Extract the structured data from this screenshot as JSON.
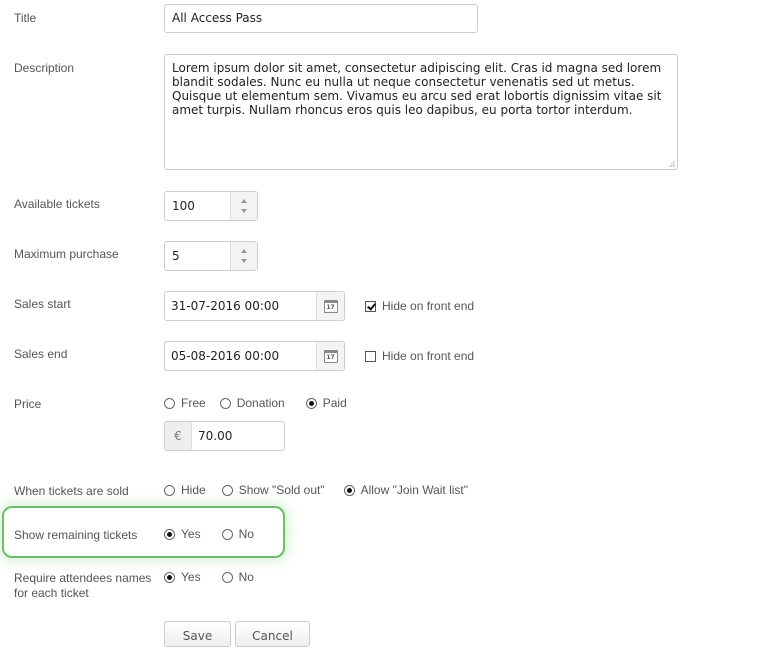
{
  "form": {
    "title": {
      "label": "Title",
      "value": "All Access Pass"
    },
    "description": {
      "label": "Description",
      "value": "Lorem ipsum dolor sit amet, consectetur adipiscing elit. Cras id magna sed lorem blandit sodales. Nunc eu nulla ut neque consectetur venenatis sed ut metus. Quisque ut elementum sem. Vivamus eu arcu sed erat lobortis dignissim vitae sit amet turpis. Nullam rhoncus eros quis leo dapibus, eu porta tortor interdum."
    },
    "available_tickets": {
      "label": "Available tickets",
      "value": "100"
    },
    "maximum_purchase": {
      "label": "Maximum purchase",
      "value": "5"
    },
    "sales_start": {
      "label": "Sales start",
      "value": "31-07-2016 00:00",
      "calendar_day": "17",
      "hide_label": "Hide on front end",
      "hide_checked": true
    },
    "sales_end": {
      "label": "Sales end",
      "value": "05-08-2016 00:00",
      "calendar_day": "17",
      "hide_label": "Hide on front end",
      "hide_checked": false
    },
    "price": {
      "label": "Price",
      "options": [
        {
          "label": "Free",
          "checked": false
        },
        {
          "label": "Donation",
          "checked": false
        },
        {
          "label": "Paid",
          "checked": true
        }
      ],
      "currency_symbol": "€",
      "amount": "70.00"
    },
    "when_sold": {
      "label": "When tickets are sold",
      "options": [
        {
          "label": "Hide",
          "checked": false
        },
        {
          "label": "Show \"Sold out\"",
          "checked": false
        },
        {
          "label": "Allow \"Join Wait list\"",
          "checked": true
        }
      ]
    },
    "show_remaining": {
      "label": "Show remaining tickets",
      "options": [
        {
          "label": "Yes",
          "checked": true
        },
        {
          "label": "No",
          "checked": false
        }
      ],
      "highlight_color": "#6abf69"
    },
    "require_names": {
      "label_line1": "Require attendees names",
      "label_line2": "for each ticket",
      "options": [
        {
          "label": "Yes",
          "checked": true
        },
        {
          "label": "No",
          "checked": false
        }
      ]
    }
  },
  "actions": {
    "save_label": "Save",
    "cancel_label": "Cancel"
  }
}
